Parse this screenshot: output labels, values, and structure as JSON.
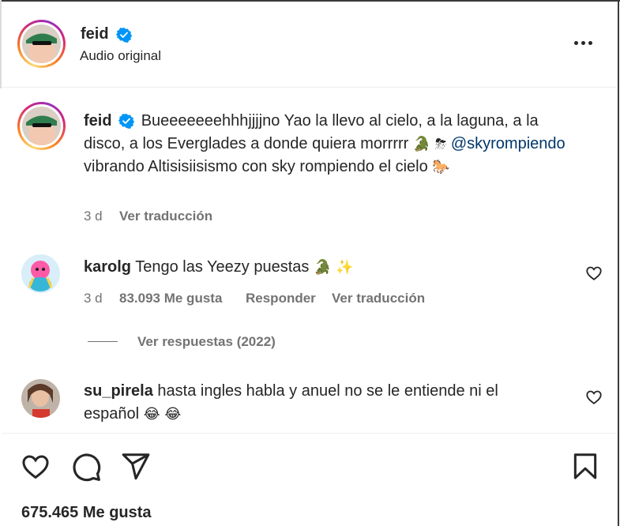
{
  "header": {
    "username": "feid",
    "subtitle": "Audio original"
  },
  "caption": {
    "username": "feid",
    "text_part1": "Bueeeeeeehhhjjjjno Yao la llevo al cielo, a la laguna, a la disco, a los Everglades a donde quiera morrrrr",
    "emoji1": "🐊",
    "emoji2": "⛈",
    "mention": "@skyrompiendo",
    "text_part2": "vibrando Altisisiisismo con sky rompiendo el cielo",
    "emoji3": "🐎",
    "time": "3 d",
    "translate": "Ver traducción"
  },
  "comments": [
    {
      "username": "karolg",
      "text": "Tengo las Yeezy puestas",
      "emoji1": "🐊",
      "emoji2": "✨",
      "time": "3 d",
      "likes": "83.093 Me gusta",
      "reply": "Responder",
      "translate": "Ver traducción",
      "view_replies": "Ver respuestas (2022)"
    },
    {
      "username": "su_pirela",
      "text": "hasta ingles habla y anuel no se le entiende ni el español",
      "emoji1": "😂",
      "emoji2": "😂"
    }
  ],
  "actions": {
    "likes": "675.465 Me gusta"
  },
  "icons": [
    "verified-badge-icon",
    "more-options-icon",
    "heart-icon",
    "comment-icon",
    "share-icon",
    "bookmark-icon"
  ],
  "colors": {
    "verified": "#0095f6",
    "mention": "#00376b",
    "secondary_text": "#737373"
  }
}
